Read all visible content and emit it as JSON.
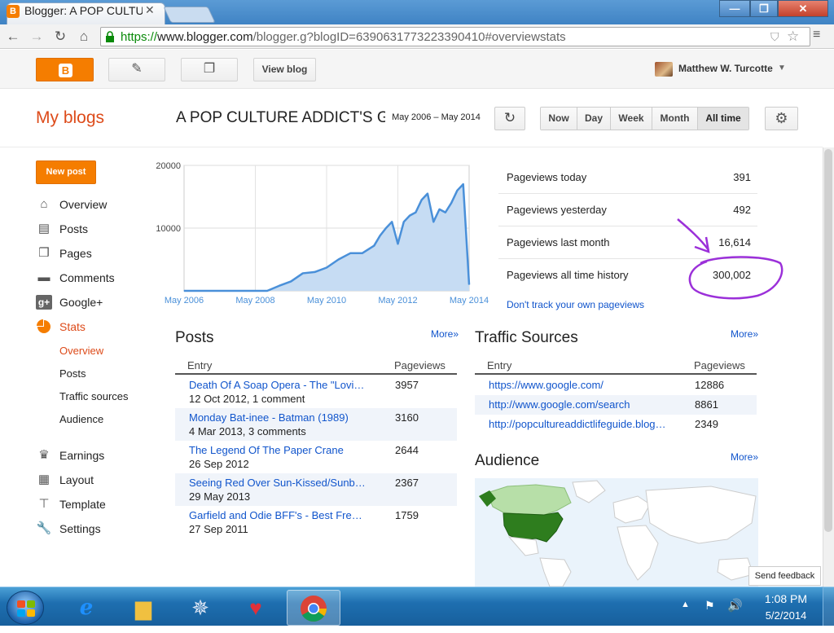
{
  "browser": {
    "tab_title": "Blogger: A POP CULTURE ADDICT'S GUIDE TO LIFE",
    "url_scheme": "https://",
    "url_host": "www.blogger.com",
    "url_path": "/blogger.g?blogID=6390631773223390410#overviewstats"
  },
  "header": {
    "view_blog": "View blog",
    "user_name": "Matthew W. Turcotte"
  },
  "page": {
    "my_blogs": "My blogs",
    "blog_title": "A POP CULTURE ADDICT'S GUIDE TO LIFE",
    "date_range": "May 2006 – May 2014",
    "range_buttons": [
      "Now",
      "Day",
      "Week",
      "Month",
      "All time"
    ],
    "active_range": "All time"
  },
  "sidebar": {
    "new_post": "New post",
    "items": [
      {
        "label": "Overview",
        "icon": "home-icon"
      },
      {
        "label": "Posts",
        "icon": "posts-icon"
      },
      {
        "label": "Pages",
        "icon": "pages-icon"
      },
      {
        "label": "Comments",
        "icon": "comments-icon"
      },
      {
        "label": "Google+",
        "icon": "google-plus-icon"
      },
      {
        "label": "Stats",
        "icon": "stats-pie-icon"
      }
    ],
    "stats_sub": [
      "Overview",
      "Posts",
      "Traffic sources",
      "Audience"
    ],
    "bottom_items": [
      {
        "label": "Earnings",
        "icon": "trophy-icon"
      },
      {
        "label": "Layout",
        "icon": "layout-icon"
      },
      {
        "label": "Template",
        "icon": "template-icon"
      },
      {
        "label": "Settings",
        "icon": "wrench-icon"
      }
    ]
  },
  "stats": {
    "rows": [
      {
        "label": "Pageviews today",
        "value": "391"
      },
      {
        "label": "Pageviews yesterday",
        "value": "492"
      },
      {
        "label": "Pageviews last month",
        "value": "16,614"
      },
      {
        "label": "Pageviews all time history",
        "value": "300,002"
      }
    ],
    "dont_track": "Don't track your own pageviews"
  },
  "posts": {
    "title": "Posts",
    "more": "More»",
    "col_entry": "Entry",
    "col_pageviews": "Pageviews",
    "rows": [
      {
        "title": "Death Of A Soap Opera - The \"Lovi…",
        "meta": "12 Oct 2012, 1 comment",
        "pageviews": "3957"
      },
      {
        "title": "Monday Bat-inee - Batman (1989)",
        "meta": "4 Mar 2013, 3 comments",
        "pageviews": "3160"
      },
      {
        "title": "The Legend Of The Paper Crane",
        "meta": "26 Sep 2012",
        "pageviews": "2644"
      },
      {
        "title": "Seeing Red Over Sun-Kissed/Sunb…",
        "meta": "29 May 2013",
        "pageviews": "2367"
      },
      {
        "title": "Garfield and Odie BFF's - Best Fre…",
        "meta": "27 Sep 2011",
        "pageviews": "1759"
      }
    ]
  },
  "traffic": {
    "title": "Traffic Sources",
    "more": "More»",
    "col_entry": "Entry",
    "col_pageviews": "Pageviews",
    "rows": [
      {
        "url": "https://www.google.com/",
        "pageviews": "12886"
      },
      {
        "url": "http://www.google.com/search",
        "pageviews": "8861"
      },
      {
        "url": "http://popcultureaddictlifeguide.blog…",
        "pageviews": "2349"
      }
    ]
  },
  "audience": {
    "title": "Audience",
    "more": "More»",
    "colors": {
      "ocean": "#eaf3fb",
      "land": "#ffffff",
      "usa": "#2e7d1e",
      "canada": "#b7dfa8"
    }
  },
  "feedback": "Send feedback",
  "taskbar": {
    "time": "1:08 PM",
    "date": "5/2/2014"
  },
  "chart_data": {
    "type": "area",
    "title": "",
    "x": [
      "2006-05",
      "2006-09",
      "2007-01",
      "2007-05",
      "2007-09",
      "2008-01",
      "2008-05",
      "2008-09",
      "2009-01",
      "2009-05",
      "2009-09",
      "2010-01",
      "2010-05",
      "2010-09",
      "2011-01",
      "2011-05",
      "2011-09",
      "2011-11",
      "2012-01",
      "2012-03",
      "2012-05",
      "2012-07",
      "2012-09",
      "2012-11",
      "2013-01",
      "2013-03",
      "2013-05",
      "2013-07",
      "2013-09",
      "2013-11",
      "2014-01",
      "2014-03",
      "2014-05"
    ],
    "values": [
      0,
      0,
      0,
      0,
      0,
      0,
      0,
      0,
      800,
      1500,
      2800,
      3000,
      3700,
      5000,
      6000,
      6000,
      7200,
      8800,
      10000,
      11000,
      7500,
      11000,
      12000,
      12500,
      14500,
      15500,
      11000,
      13000,
      12500,
      14000,
      16000,
      17000,
      1000
    ],
    "x_tick_labels": [
      "May 2006",
      "May 2008",
      "May 2010",
      "May 2012",
      "May 2014"
    ],
    "y_tick_labels": [
      "20000",
      "10000"
    ],
    "ylim": [
      0,
      20000
    ],
    "grid": true,
    "colors": {
      "line": "#4a90d9",
      "fill": "#c6dcf3"
    }
  }
}
